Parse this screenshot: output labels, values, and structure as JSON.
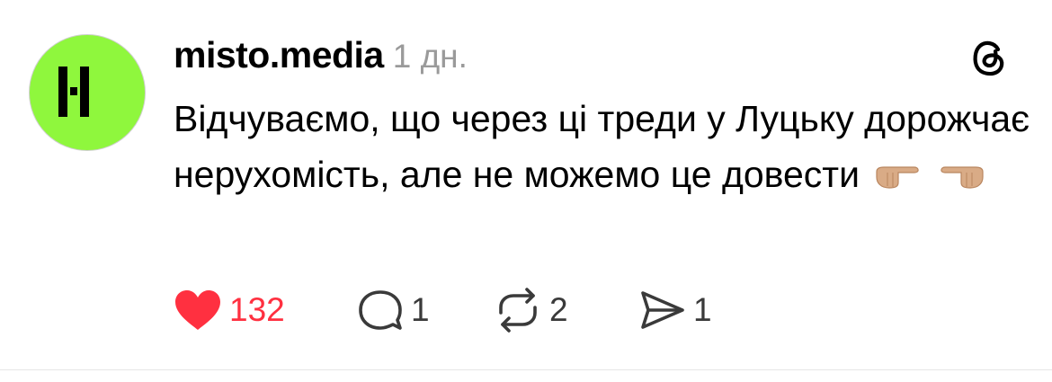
{
  "post": {
    "author": {
      "username": "misto.media",
      "avatar_label": "M logo",
      "avatar_color": "#8ff73d"
    },
    "time": "1 дн.",
    "text": "Відчуваємо, що через ці треди у Луцьку дорожчає нерухомість, але не можемо це довести",
    "emojis": [
      "finger-pointing-right",
      "finger-pointing-left"
    ],
    "app_icon": "threads-icon"
  },
  "actions": {
    "likes": {
      "count": "132",
      "icon": "heart-icon",
      "color": "#ff3040",
      "liked": true
    },
    "replies": {
      "count": "1",
      "icon": "comment-icon"
    },
    "reposts": {
      "count": "2",
      "icon": "repost-icon"
    },
    "shares": {
      "count": "1",
      "icon": "send-icon"
    }
  }
}
